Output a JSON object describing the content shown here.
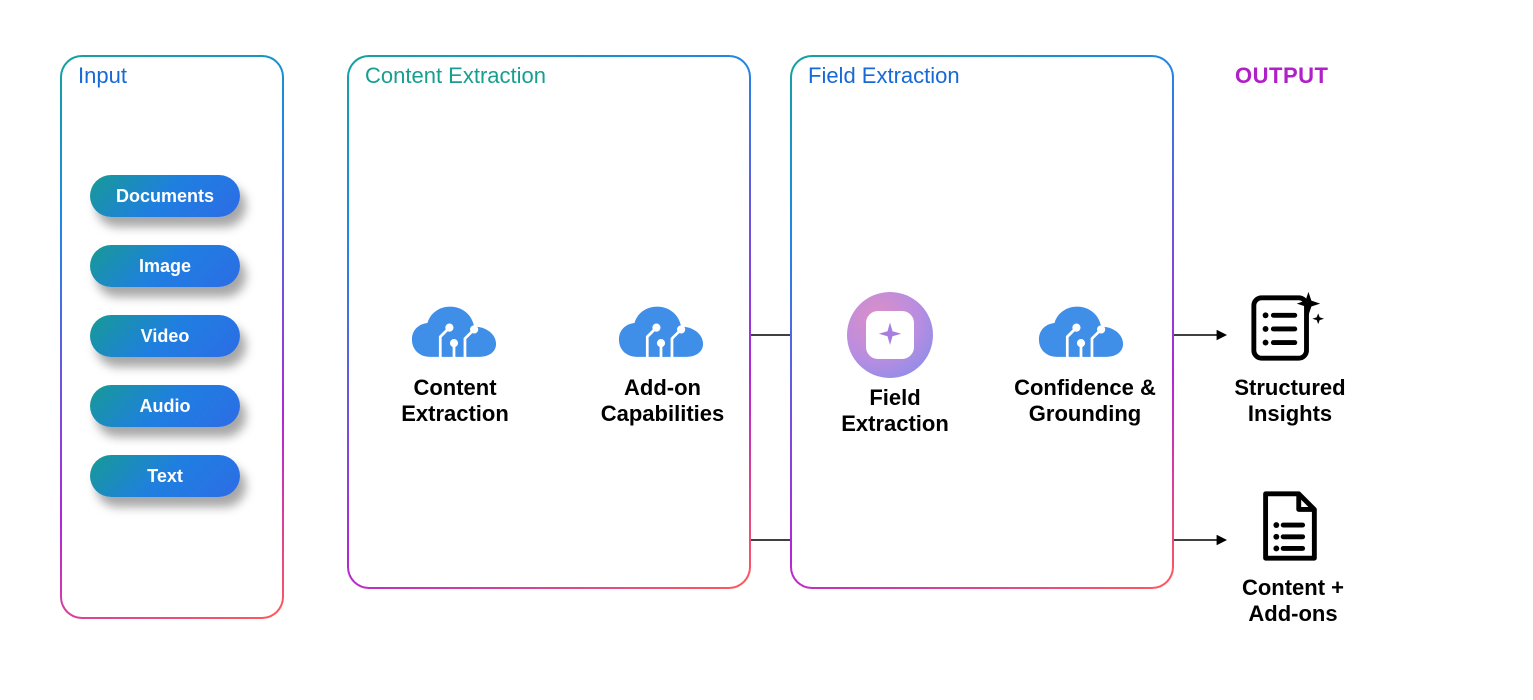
{
  "input": {
    "title": "Input",
    "pills": [
      "Documents",
      "Image",
      "Video",
      "Audio",
      "Text"
    ]
  },
  "contentExtraction": {
    "title": "Content Extraction",
    "nodes": {
      "contentExtraction": "Content\nExtraction",
      "addOn": "Add-on\nCapabilities"
    }
  },
  "fieldExtraction": {
    "title": "Field Extraction",
    "nodes": {
      "fieldExtraction": "Field\nExtraction",
      "confidence": "Confidence &\nGrounding"
    }
  },
  "output": {
    "title": "OUTPUT",
    "structuredInsights": "Structured\nInsights",
    "contentAddons": "Content +\nAdd-ons"
  },
  "colors": {
    "titleInput": "#1769d6",
    "titleContent": "#169f90",
    "titleField": "#1769d6"
  }
}
